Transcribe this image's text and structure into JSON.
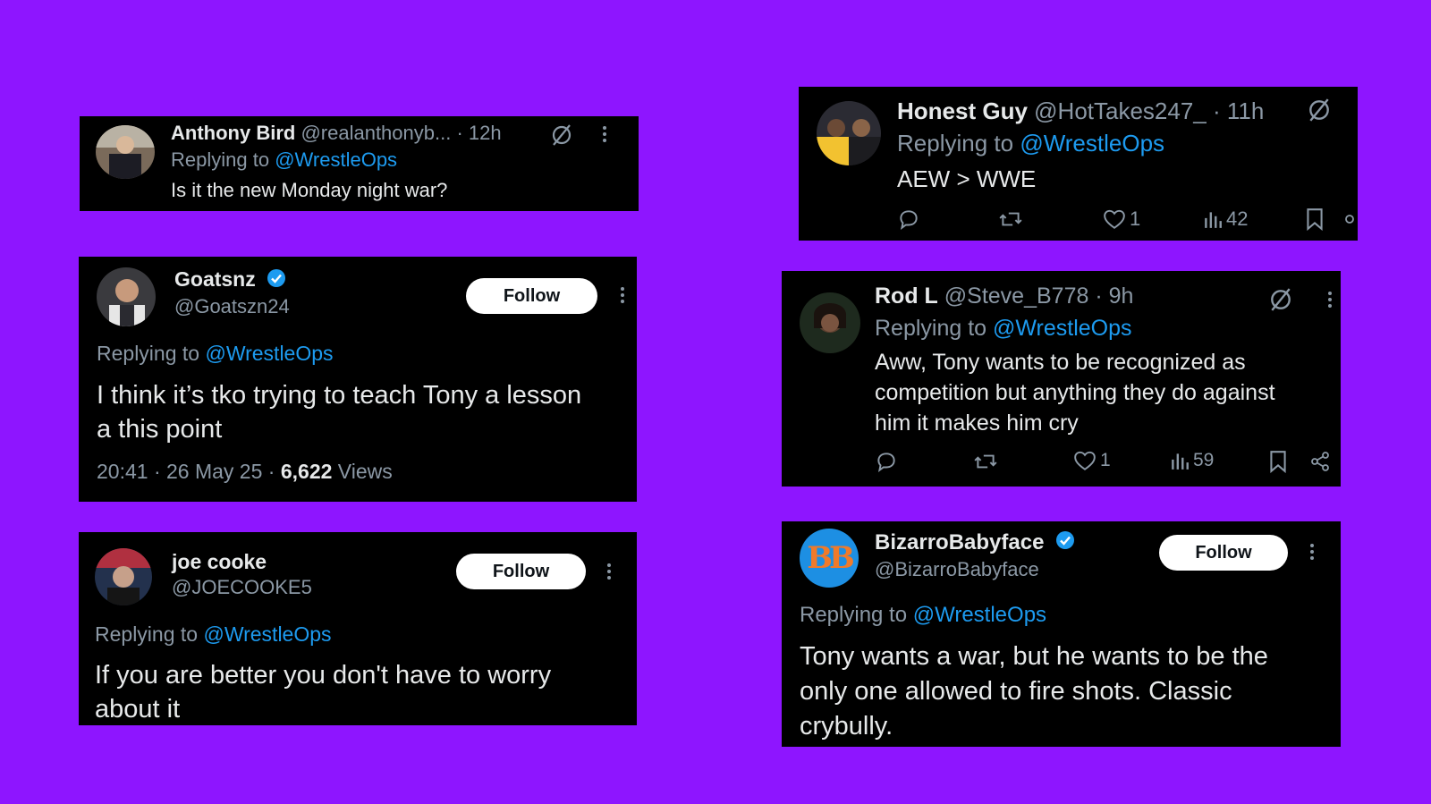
{
  "reply_prefix": "Replying to",
  "mention": "@WrestleOps",
  "follow_label": "Follow",
  "tweets": {
    "anthony": {
      "name": "Anthony Bird",
      "handle": "@realanthonyb...",
      "time": "· 12h",
      "text": "Is it the new Monday night war?"
    },
    "goatsnz": {
      "name": "Goatsnz",
      "handle": "@Goatszn24",
      "text_line1": "I think it’s tko trying to teach Tony a lesson",
      "text_line2": "a this point",
      "timestamp": "20:41 · 26 May 25 ·",
      "views_count": "6,622",
      "views_label": "Views"
    },
    "joe": {
      "name": "joe cooke",
      "handle": "@JOECOOKE5",
      "text_line1": "If you are better you don't have to worry",
      "text_line2": "about it"
    },
    "honest": {
      "name": "Honest Guy",
      "handle": "@HotTakes247_",
      "time": "· 11h",
      "text": "AEW > WWE",
      "likes": "1",
      "views": "42"
    },
    "rod": {
      "name": "Rod L",
      "handle": "@Steve_B778",
      "time": "· 9h",
      "text_line1": "Aww, Tony wants to be recognized as",
      "text_line2": "competition but anything they do against",
      "text_line3": "him it makes him cry",
      "likes": "1",
      "views": "59"
    },
    "bizarro": {
      "name": "BizarroBabyface",
      "handle": "@BizarroBabyface",
      "avatar_text": "BB",
      "text_line1": "Tony wants a war, but he wants to be the",
      "text_line2": "only one allowed to fire shots. Classic",
      "text_line3": "crybully."
    }
  },
  "colors": {
    "background": "#8e15ff",
    "card": "#000000",
    "link": "#1d9bf0",
    "secondary_text": "#8b98a5",
    "verified": "#1d9bf0",
    "bizarro_avatar": "#1d8fe3"
  },
  "icons": [
    "grok-icon",
    "more-icon",
    "verified-icon",
    "reply-icon",
    "retweet-icon",
    "like-icon",
    "views-icon",
    "bookmark-icon",
    "share-icon"
  ]
}
